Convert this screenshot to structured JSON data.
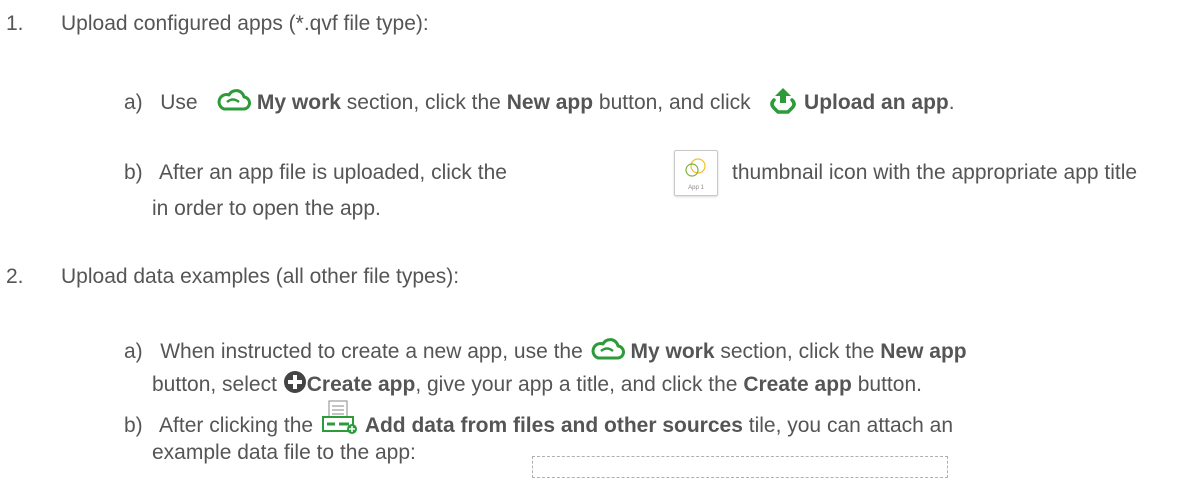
{
  "colors": {
    "text": "#555555",
    "icon_green": "#2e9b3a",
    "icon_dark": "#444444",
    "thumb_yellow": "#f2c12e"
  },
  "step1": {
    "number": "1.",
    "text": "Upload configured apps (*.qvf file type):",
    "a": {
      "letter": "a)",
      "use": "Use",
      "cloud_icon": "cloud-icon",
      "my_work": "My work",
      "section_click": "section, click the",
      "new_app": "New app",
      "button_and_click": "button, and click",
      "upload_icon": "upload-icon",
      "upload_an_app": "Upload an app",
      "end": "."
    },
    "b": {
      "letter": "b)",
      "before": "After an app file is uploaded, click the",
      "thumb_label": "App 1",
      "after": "thumbnail icon with the appropriate app title",
      "line2": "in order to open the app."
    }
  },
  "step2": {
    "number": "2.",
    "text": "Upload data examples (all other file types):",
    "a": {
      "letter": "a)",
      "before": "When instructed to create a new app, use the",
      "cloud_icon": "cloud-icon",
      "my_work": "My work",
      "section_click": "section, click the",
      "new_app": "New app",
      "l2_button_select": "button, select",
      "plus_icon": "plus-circle-icon",
      "create_app": "Create app",
      "give_title": ", give your app a title, and click the",
      "create_app2": "Create app",
      "l2_end": "button."
    },
    "b": {
      "letter": "b)",
      "after_clicking": "After clicking the",
      "tile_icon": "data-tile-icon",
      "add_data": "Add data from files and other sources",
      "tile_attach": "tile, you can attach an",
      "line2": "example data file to the app:"
    }
  }
}
